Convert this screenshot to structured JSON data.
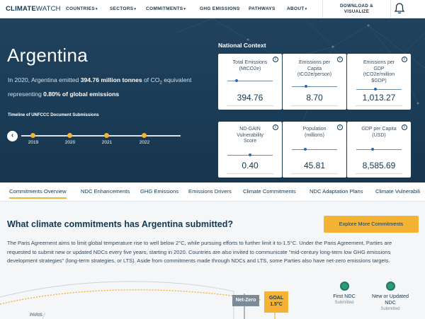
{
  "nav": {
    "logo_bold": "CLIMATE",
    "logo_thin": "WATCH",
    "items": [
      {
        "label": "COUNTRIES",
        "dropdown": true
      },
      {
        "label": "SECTORS",
        "dropdown": true
      },
      {
        "label": "COMMITMENTS",
        "dropdown": true
      },
      {
        "label": "GHG EMISSIONS",
        "dropdown": false
      },
      {
        "label": "PATHWAYS",
        "dropdown": false
      },
      {
        "label": "ABOUT",
        "dropdown": true
      }
    ],
    "caret": "▾",
    "download_line1": "DOWNLOAD &",
    "download_line2": "VISUALIZE",
    "bell_icon": "bell-icon"
  },
  "hero": {
    "country": "Argentina",
    "summary_pre": "In 2020, Argentina emitted ",
    "summary_amount": "394.76 million tonnes",
    "summary_mid": " of CO",
    "summary_sub": "2",
    "summary_mid2": " equivalent representing ",
    "summary_share": "0.80% of global emissions",
    "timeline_title": "Timeline of UNFCCC Document Submissions",
    "timeline_prev_icon": "chevron-left-icon",
    "timeline_prev_glyph": "‹",
    "timeline_years": [
      "2019",
      "2020",
      "2021",
      "2022"
    ],
    "accent": "#f5b335"
  },
  "national_context": {
    "title": "National Context",
    "info_glyph": "i",
    "cards": [
      {
        "label": "Total Emissions\n(MtCO2e)",
        "value": "394.76",
        "level": 0.18
      },
      {
        "label": "Emissions per\nCapita\n(tCO2e/person)",
        "value": "8.70",
        "level": 0.3
      },
      {
        "label": "Emissions per\nGDP\n(tCO2e/million\n$GDP)",
        "value": "1,013.27",
        "level": 0.42
      },
      {
        "label": "ND-GAIN\nVulnerability\nScore",
        "value": "0.40",
        "level": 0.5
      },
      {
        "label": "Population\n(millions)",
        "value": "45.81",
        "level": 0.28
      },
      {
        "label": "GDP per Capita\n(USD)",
        "value": "8,585.69",
        "level": 0.35
      }
    ]
  },
  "tabs": [
    {
      "label": "Commitments Overview",
      "active": true
    },
    {
      "label": "NDC Enhancements",
      "active": false
    },
    {
      "label": "GHG Emissions",
      "active": false
    },
    {
      "label": "Emissions Drivers",
      "active": false
    },
    {
      "label": "Climate Commitments",
      "active": false
    },
    {
      "label": "NDC Adaptation Plans",
      "active": false
    },
    {
      "label": "Climate Vulnerabili",
      "active": false
    }
  ],
  "main": {
    "title": "What climate commitments has Argentina submitted?",
    "explore_label": "Explore More Commitments",
    "paragraph_lines": [
      "The Paris Agreement aims to limit global temperature rise to well below 2°C, while pursuing efforts to further limit it to 1.5°C. Under the Paris Agreement, Parties are",
      "requested to submit new or updated NDCs every five years, starting in 2020. Countries are also invited to communicate \"mid-century long-term low GHG emissions",
      "development strategies\" (long-term strategies, or LTS). Aside from commitments made through NDCs and LTS, some Parties also have net-zero emissions targets."
    ],
    "journey": {
      "paris": "PARIS",
      "net_zero": "Net-Zero",
      "goal_line1": "GOAL",
      "goal_line2": "1.5°C",
      "ndcs": [
        {
          "label_line1": "First NDC",
          "label_line2": "",
          "status": "Submitted"
        },
        {
          "label_line1": "New or Updated",
          "label_line2": "NDC",
          "status": "Submitted"
        }
      ]
    }
  }
}
